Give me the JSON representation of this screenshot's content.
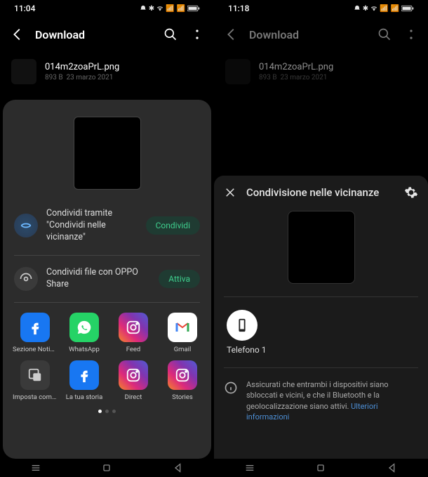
{
  "left": {
    "time": "11:04",
    "screen_title": "Download",
    "file": {
      "name": "014m2zoaPrL.png",
      "size": "893 B",
      "date": "23 marzo 2021"
    },
    "nearby": {
      "line1": "Condividi tramite",
      "line2": "\"Condividi nelle vicinanze\"",
      "button": "Condividi"
    },
    "oppo": {
      "text": "Condividi file con OPPO Share",
      "button": "Attiva"
    },
    "apps_row1": [
      "Sezione Notizie",
      "WhatsApp",
      "Feed",
      "Gmail"
    ],
    "apps_row2": [
      "Imposta come immagine del ...",
      "La tua storia",
      "Direct",
      "Stories"
    ]
  },
  "right": {
    "time": "11:18",
    "screen_title": "Download",
    "file": {
      "name": "014m2zoaPrL.png",
      "size": "893 B",
      "date": "23 marzo 2021"
    },
    "sheet_title": "Condivisione nelle vicinanze",
    "device": "Telefono 1",
    "info": "Assicurati che entrambi i dispositivi siano sbloccati e vicini, e che il Bluetooth e la geolocalizzazione siano attivi.",
    "info_link": "Ulteriori informazioni"
  }
}
